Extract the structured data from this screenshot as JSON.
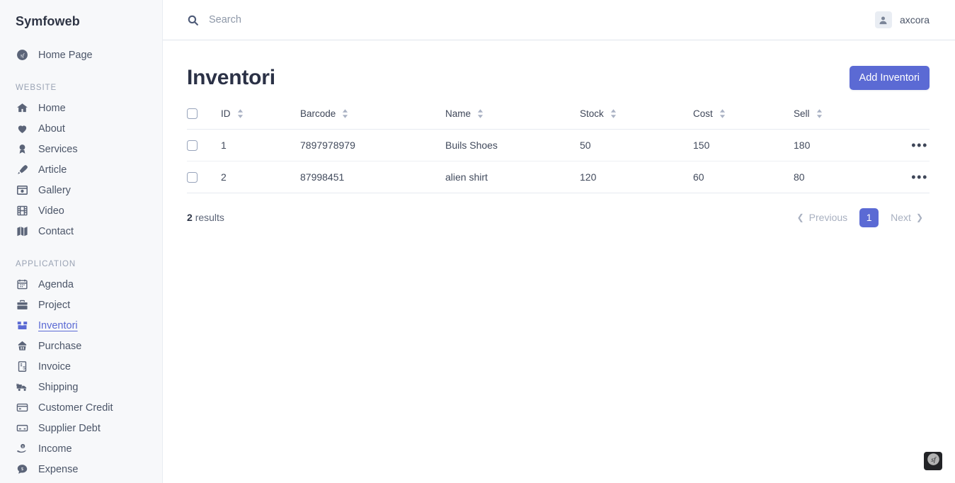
{
  "brand": {
    "name": "Symfoweb"
  },
  "sidebar": {
    "top_items": [
      {
        "label": "Home Page",
        "icon": "symfony-logo-icon",
        "active": false
      }
    ],
    "groups": [
      {
        "title": "WEBSITE",
        "items": [
          {
            "label": "Home",
            "icon": "home-icon",
            "active": false
          },
          {
            "label": "About",
            "icon": "heart-icon",
            "active": false
          },
          {
            "label": "Services",
            "icon": "award-icon",
            "active": false
          },
          {
            "label": "Article",
            "icon": "pen-icon",
            "active": false
          },
          {
            "label": "Gallery",
            "icon": "image-icon",
            "active": false
          },
          {
            "label": "Video",
            "icon": "film-icon",
            "active": false
          },
          {
            "label": "Contact",
            "icon": "map-icon",
            "active": false
          }
        ]
      },
      {
        "title": "APPLICATION",
        "items": [
          {
            "label": "Agenda",
            "icon": "calendar-icon",
            "active": false
          },
          {
            "label": "Project",
            "icon": "briefcase-icon",
            "active": false
          },
          {
            "label": "Inventori",
            "icon": "box-icon",
            "active": true
          },
          {
            "label": "Purchase",
            "icon": "basket-icon",
            "active": false
          },
          {
            "label": "Invoice",
            "icon": "invoice-icon",
            "active": false
          },
          {
            "label": "Shipping",
            "icon": "truck-icon",
            "active": false
          },
          {
            "label": "Customer Credit",
            "icon": "credit-card-icon",
            "active": false
          },
          {
            "label": "Supplier Debt",
            "icon": "card-icon",
            "active": false
          },
          {
            "label": "Income",
            "icon": "hand-coin-icon",
            "active": false
          },
          {
            "label": "Expense",
            "icon": "coin-chat-icon",
            "active": false
          }
        ]
      }
    ]
  },
  "topbar": {
    "search": {
      "placeholder": "Search",
      "value": "",
      "icon": "search-icon"
    },
    "user": {
      "name": "axcora",
      "avatar_icon": "user-avatar-icon"
    }
  },
  "page": {
    "title": "Inventori",
    "add_button_label": "Add Inventori"
  },
  "table": {
    "columns": [
      {
        "key": "id",
        "label": "ID",
        "sortable": true
      },
      {
        "key": "barcode",
        "label": "Barcode",
        "sortable": true
      },
      {
        "key": "name",
        "label": "Name",
        "sortable": true
      },
      {
        "key": "stock",
        "label": "Stock",
        "sortable": true
      },
      {
        "key": "cost",
        "label": "Cost",
        "sortable": true
      },
      {
        "key": "sell",
        "label": "Sell",
        "sortable": true
      }
    ],
    "rows": [
      {
        "id": "1",
        "barcode": "7897978979",
        "name": "Buils Shoes",
        "stock": "50",
        "cost": "150",
        "sell": "180",
        "actions": "•••"
      },
      {
        "id": "2",
        "barcode": "87998451",
        "name": "alien shirt",
        "stock": "120",
        "cost": "60",
        "sell": "80",
        "actions": "•••"
      }
    ]
  },
  "footer": {
    "results_count": "2",
    "results_label": "results",
    "pagination": {
      "previous_label": "Previous",
      "next_label": "Next",
      "current_page": "1"
    }
  },
  "debug_toolbar": {
    "icon": "symfony-logo-icon"
  },
  "colors": {
    "accent": "#5b6ad4",
    "sidebar_bg": "#f7f8fa",
    "text": "#3e4658",
    "muted": "#9aa3b4"
  }
}
